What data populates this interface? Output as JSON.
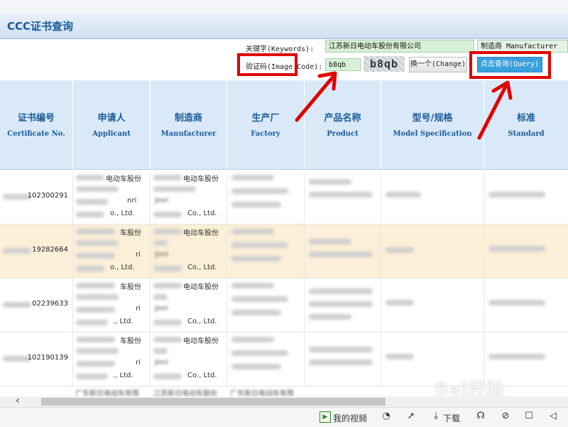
{
  "header": {
    "title": "CCC证书查询"
  },
  "form": {
    "keywords_label": "关键字(Keywords):",
    "keywords_value": "江苏新日电动车股份有限公司",
    "field_select": "制造商 Manufacturer",
    "captcha_label": "验证码(Image Code):",
    "captcha_value": "b8qb",
    "captcha_image_text": "b8qb",
    "change_button": "换一个(Change)",
    "query_button": "点击查询(Query)"
  },
  "table": {
    "columns": [
      {
        "zh": "证书编号",
        "en": "Certificate No."
      },
      {
        "zh": "申请人",
        "en": "Applicant"
      },
      {
        "zh": "制造商",
        "en": "Manufacturer"
      },
      {
        "zh": "生产厂",
        "en": "Factory"
      },
      {
        "zh": "产品名称",
        "en": "Product"
      },
      {
        "zh": "型号/规格",
        "en": "Model Specification"
      },
      {
        "zh": "标准",
        "en": "Standard"
      }
    ],
    "rows": [
      {
        "cert": "102300291",
        "app1": "电动车股份",
        "app2": "nri",
        "app3": "o., Ltd.",
        "man1": "电动车股份",
        "man2": "Jinri",
        "man3": "Co., Ltd."
      },
      {
        "cert": "19282664",
        "app1": "车股份",
        "app2": "ri",
        "app3": "o., Ltd.",
        "man1": "电动车股份",
        "man2": "Jinri",
        "man3": "Co., Ltd."
      },
      {
        "cert": "02239633",
        "app1": "车股份",
        "app2": "ri",
        "app3": "., Ltd.",
        "man1": "电动车股份",
        "man2": "Jinri",
        "man3": "Co., Ltd."
      },
      {
        "cert": "102190139",
        "app1": "车股份",
        "app2": "ri",
        "app3": "., Ltd.",
        "man1": "电动车股份",
        "man2": "Jinri",
        "man3": "Co., Ltd."
      }
    ],
    "partial_row": {
      "app": "广东新日电动车有限",
      "man": "江苏新日电动车股份",
      "fac": "广东新日电动车有限"
    }
  },
  "statusbar": {
    "my_video": "我的视频",
    "download": "下载"
  },
  "watermark": "Bai经验",
  "colors": {
    "header_blue": "#1a5b9a",
    "table_head_bg": "#d9e9f7",
    "highlight_row": "#fcefd8",
    "query_btn": "#3aa0dc",
    "annotation_red": "#e00000"
  }
}
